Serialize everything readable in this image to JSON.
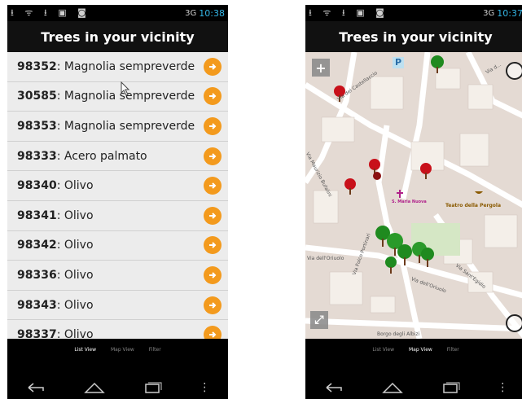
{
  "status_bar": {
    "time": "10:38",
    "time_right": "10:37",
    "icons": "⭳ ᯤ ⭳ ▣ ◙",
    "signal": "3G"
  },
  "left_screen": {
    "title": "Trees in your vicinity",
    "items": [
      {
        "id": "98352",
        "name": ": Magnolia sempreverde"
      },
      {
        "id": "30585",
        "name": ": Magnolia sempreverde"
      },
      {
        "id": "98353",
        "name": ": Magnolia sempreverde"
      },
      {
        "id": "98333",
        "name": ": Acero palmato"
      },
      {
        "id": "98340",
        "name": ": Olivo"
      },
      {
        "id": "98341",
        "name": ": Olivo"
      },
      {
        "id": "98342",
        "name": ": Olivo"
      },
      {
        "id": "98336",
        "name": ": Olivo"
      },
      {
        "id": "98343",
        "name": ": Olivo"
      },
      {
        "id": "98337",
        "name": ": Olivo"
      }
    ],
    "tabs": {
      "list": "List View",
      "map": "Map View",
      "filter": "Filter"
    }
  },
  "right_screen": {
    "title": "Trees in your vicinity",
    "map_labels": {
      "via_maurizio": "Via Maurizio Bufalini",
      "via_folco": "Via Folco Portinari",
      "via_oriuolo": "Via dell'Oriuolo",
      "via_oriuolo2": "Via dell'Oriuolo",
      "via_castellaccio": "Via del Castellaccio",
      "via_sant_egidio": "Via Sant'Egidio",
      "borgo_albizi": "Borgo degli Albizi",
      "teatro": "Teatro della Pergola",
      "santa_maria": "S. Maria Nuova",
      "via_top_right": "Via d...",
      "parking": "P"
    },
    "tabs": {
      "list": "List View",
      "map": "Map View",
      "filter": "Filter"
    }
  },
  "colors": {
    "accent": "#f39a1d",
    "status_time": "#33b5e5",
    "tree_red": "#c8101a",
    "tree_green": "#1f8a1f"
  }
}
